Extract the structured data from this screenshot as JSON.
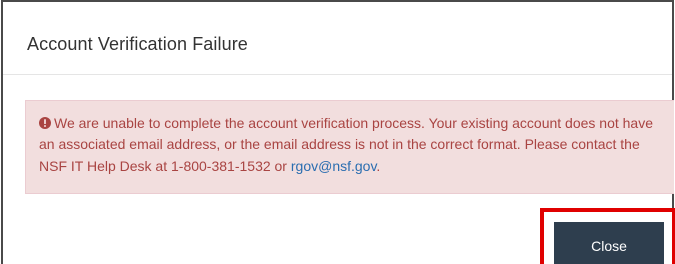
{
  "dialog": {
    "title": "Account Verification Failure",
    "alert": {
      "message": "We are unable to complete the account verification process. Your existing account does not have an associated email address, or the email address is not in the correct format. Please contact the NSF IT Help Desk at 1-800-381-1532 or",
      "link_text": "rgov@nsf.gov",
      "trailing": ".",
      "icon": "exclamation-circle-icon"
    },
    "close_label": "Close"
  },
  "colors": {
    "alert_bg": "#f2dede",
    "alert_text": "#a94442",
    "link": "#2a6db0",
    "button_bg": "#2e3e4e",
    "highlight": "#e00000"
  }
}
